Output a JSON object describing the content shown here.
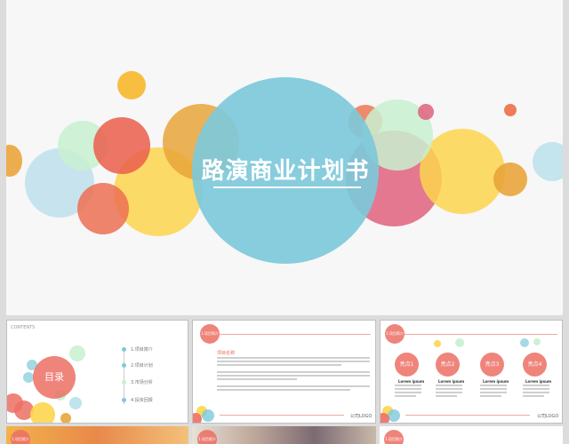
{
  "main": {
    "title": "路演商业计划书"
  },
  "thumb1": {
    "corner_label": "CONTENTS",
    "toc_title": "目录",
    "items": [
      "1.项目简介",
      "2.项目计划",
      "3.市场分析",
      "4.投资回报"
    ]
  },
  "thumb2": {
    "badge": "1.项目简介",
    "heading": "项目名称",
    "footer": "公司LOGO"
  },
  "thumb3": {
    "badge": "1.项目简介",
    "points": [
      "亮点1",
      "亮点2",
      "亮点3",
      "亮点4"
    ],
    "point_caption": "Lorem ipsum",
    "footer": "公司LOGO"
  },
  "thumb4": {
    "badge": "1.项目简介"
  },
  "thumb5": {
    "badge": "1.项目简介"
  },
  "thumb6": {
    "badge": "1.项目简介"
  },
  "colors": {
    "teal": "#7dc9da",
    "coral": "#ec6e64",
    "yellow": "#fdd54e",
    "orange": "#e9a43a",
    "mint": "#c8f0d0",
    "pink": "#e1617e"
  }
}
